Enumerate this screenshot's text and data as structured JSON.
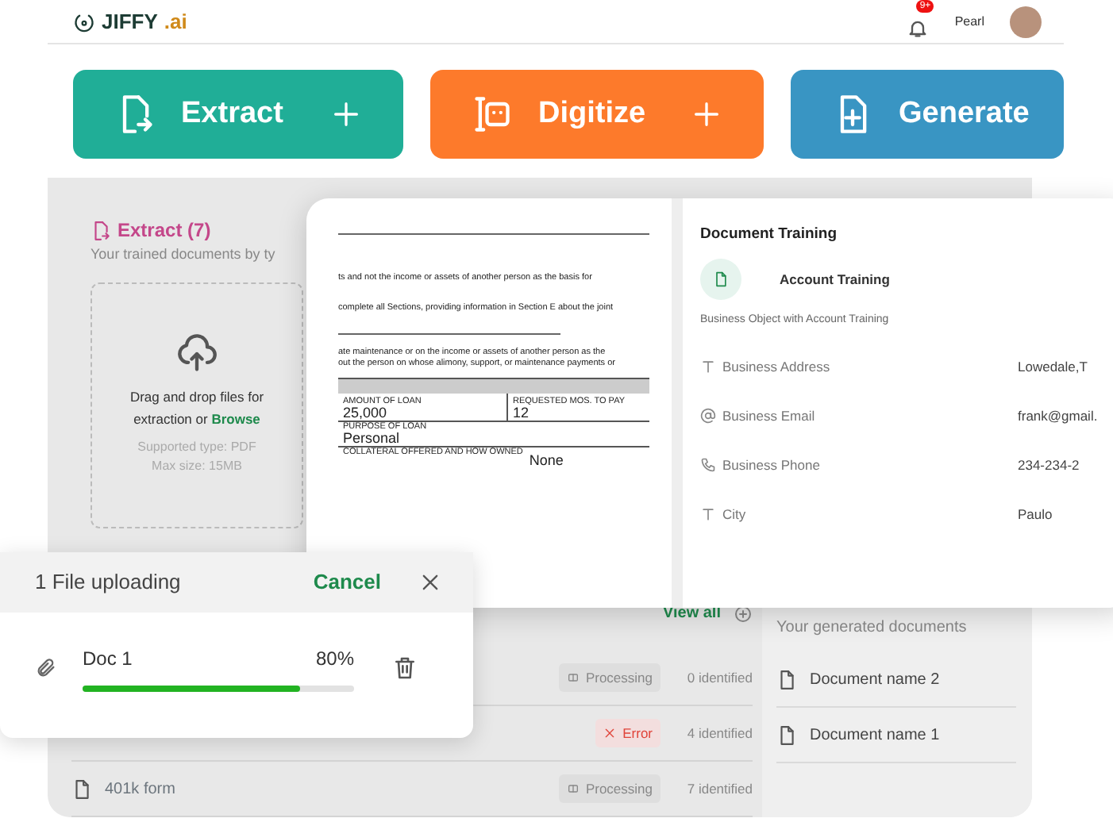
{
  "header": {
    "logo_text": "JIFFY",
    "logo_suffix": ".ai",
    "notification_badge": "9+",
    "user_name": "Pearl"
  },
  "actions": [
    {
      "label": "Extract",
      "kind": "extract",
      "has_add": true
    },
    {
      "label": "Digitize",
      "kind": "digitize",
      "has_add": true
    },
    {
      "label": "Generate",
      "kind": "generate",
      "has_add": false
    }
  ],
  "extract": {
    "title": "Extract (7)",
    "subtitle": "Your trained documents by ty",
    "dropzone": {
      "prompt": "Drag and drop files for extraction or",
      "browse": "Browse",
      "supported": "Supported type: PDF",
      "max_size": "Max size: 15MB"
    }
  },
  "documents": {
    "view_all": "View all",
    "rows": [
      {
        "name": "",
        "kind": "processing",
        "status_label": "Processing",
        "count": "0 identified"
      },
      {
        "name": "",
        "kind": "error",
        "status_label": "Error",
        "count": "4 identified"
      },
      {
        "name": "401k form",
        "kind": "processing",
        "status_label": "Processing",
        "count": "7 identified"
      }
    ]
  },
  "generate": {
    "subtitle": "Your generated documents",
    "items": [
      "Document name 2",
      "Document name 1"
    ]
  },
  "training": {
    "document": {
      "lines_top": [
        "ts and not the income or assets of another person as the basis for",
        "complete all Sections, providing information in Section E about the joint"
      ],
      "lines_mid": [
        "ate maintenance or on the income or assets of another person as the",
        "out the person on whose alimony, support, or maintenance payments or"
      ],
      "table": [
        {
          "label": "AMOUNT OF LOAN",
          "value": "25,000"
        },
        {
          "label": "REQUESTED MOS. TO PAY",
          "value": "12"
        },
        {
          "label": "PURPOSE OF LOAN",
          "value": "Personal"
        },
        {
          "label": "COLLATERAL OFFERED AND HOW OWNED",
          "value": "None"
        }
      ]
    },
    "panel": {
      "title": "Document Training",
      "object_name": "Account Training",
      "object_description": "Business Object with Account Training",
      "fields": [
        {
          "kind": "text",
          "label": "Business Address",
          "value": "Lowedale,T"
        },
        {
          "kind": "email",
          "label": "Business Email",
          "value": "frank@gmail."
        },
        {
          "kind": "phone",
          "label": "Business Phone",
          "value": "234-234-2"
        },
        {
          "kind": "text",
          "label": "City",
          "value": "Paulo"
        }
      ]
    }
  },
  "upload": {
    "title": "1 File uploading",
    "cancel": "Cancel",
    "files": [
      {
        "name": "Doc 1",
        "percent": "80%",
        "level": 0.8
      }
    ]
  }
}
